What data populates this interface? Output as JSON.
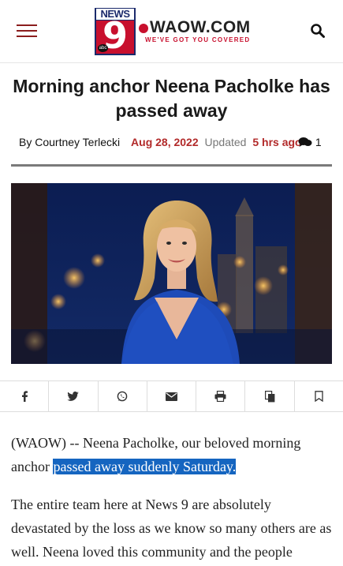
{
  "header": {
    "logo": {
      "news": "NEWS",
      "nine": "9",
      "abc": "abc",
      "site": "WAOW.COM",
      "tagline": "WE'VE GOT YOU COVERED"
    },
    "icons": {
      "menu": "hamburger-menu-icon",
      "search": "search-icon"
    }
  },
  "article": {
    "title": "Morning anchor Neena Pacholke has passed away",
    "byline": "By Courtney Terlecki",
    "date": "Aug 28, 2022",
    "updated_label": "Updated",
    "updated_ago": "5 hrs ago",
    "comment_count": "1",
    "paragraph1_text": "(WAOW) -- Neena Pacholke, our beloved morning anchor ",
    "paragraph1_highlight": "passed away suddenly Saturday.",
    "paragraph2": "The entire team here at News 9 are absolutely devastated by the loss as we know so many others are as well.  Neena loved this community and the people"
  },
  "share": [
    {
      "name": "facebook-icon"
    },
    {
      "name": "twitter-icon"
    },
    {
      "name": "whatsapp-icon"
    },
    {
      "name": "email-icon"
    },
    {
      "name": "print-icon"
    },
    {
      "name": "copy-icon"
    },
    {
      "name": "bookmark-icon"
    }
  ],
  "colors": {
    "accent_red": "#b22a2a",
    "brand_navy": "#1b2a6b",
    "brand_red": "#c8102e",
    "highlight": "#1565c0"
  }
}
